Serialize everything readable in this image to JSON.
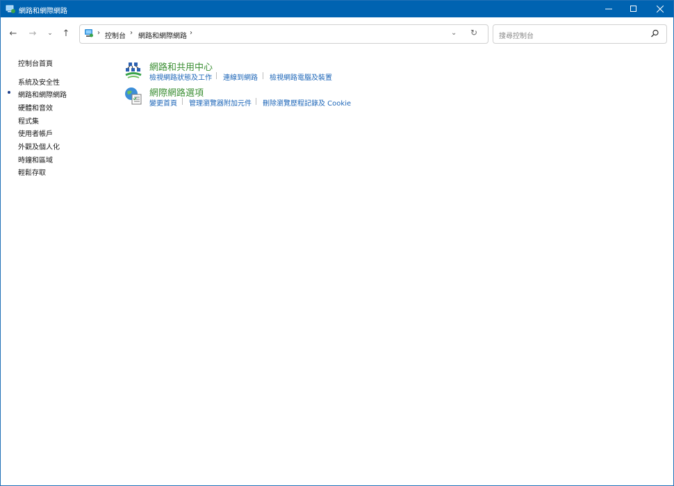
{
  "window": {
    "title": "網路和網際網路"
  },
  "address": {
    "breadcrumbs": [
      "控制台",
      "網路和網際網路"
    ]
  },
  "search": {
    "placeholder": "搜尋控制台"
  },
  "sidebar": {
    "items": [
      {
        "label": "控制台首頁",
        "current": false
      },
      {
        "label": "系統及安全性",
        "current": false
      },
      {
        "label": "網路和網際網路",
        "current": true
      },
      {
        "label": "硬體和音效",
        "current": false
      },
      {
        "label": "程式集",
        "current": false
      },
      {
        "label": "使用者帳戶",
        "current": false
      },
      {
        "label": "外觀及個人化",
        "current": false
      },
      {
        "label": "時鐘和區域",
        "current": false
      },
      {
        "label": "輕鬆存取",
        "current": false
      }
    ]
  },
  "categories": [
    {
      "title": "網路和共用中心",
      "icon": "network-sharing-center-icon",
      "tasks": [
        "檢視網路狀態及工作",
        "連線到網路",
        "檢視網路電腦及裝置"
      ]
    },
    {
      "title": "網際網路選項",
      "icon": "internet-options-icon",
      "tasks": [
        "變更首頁",
        "管理瀏覽器附加元件",
        "刪除瀏覽歷程記錄及 Cookie"
      ]
    }
  ],
  "colors": {
    "titlebar": "#0063b1",
    "category_title": "#3c8f34",
    "link": "#1d66b8"
  }
}
